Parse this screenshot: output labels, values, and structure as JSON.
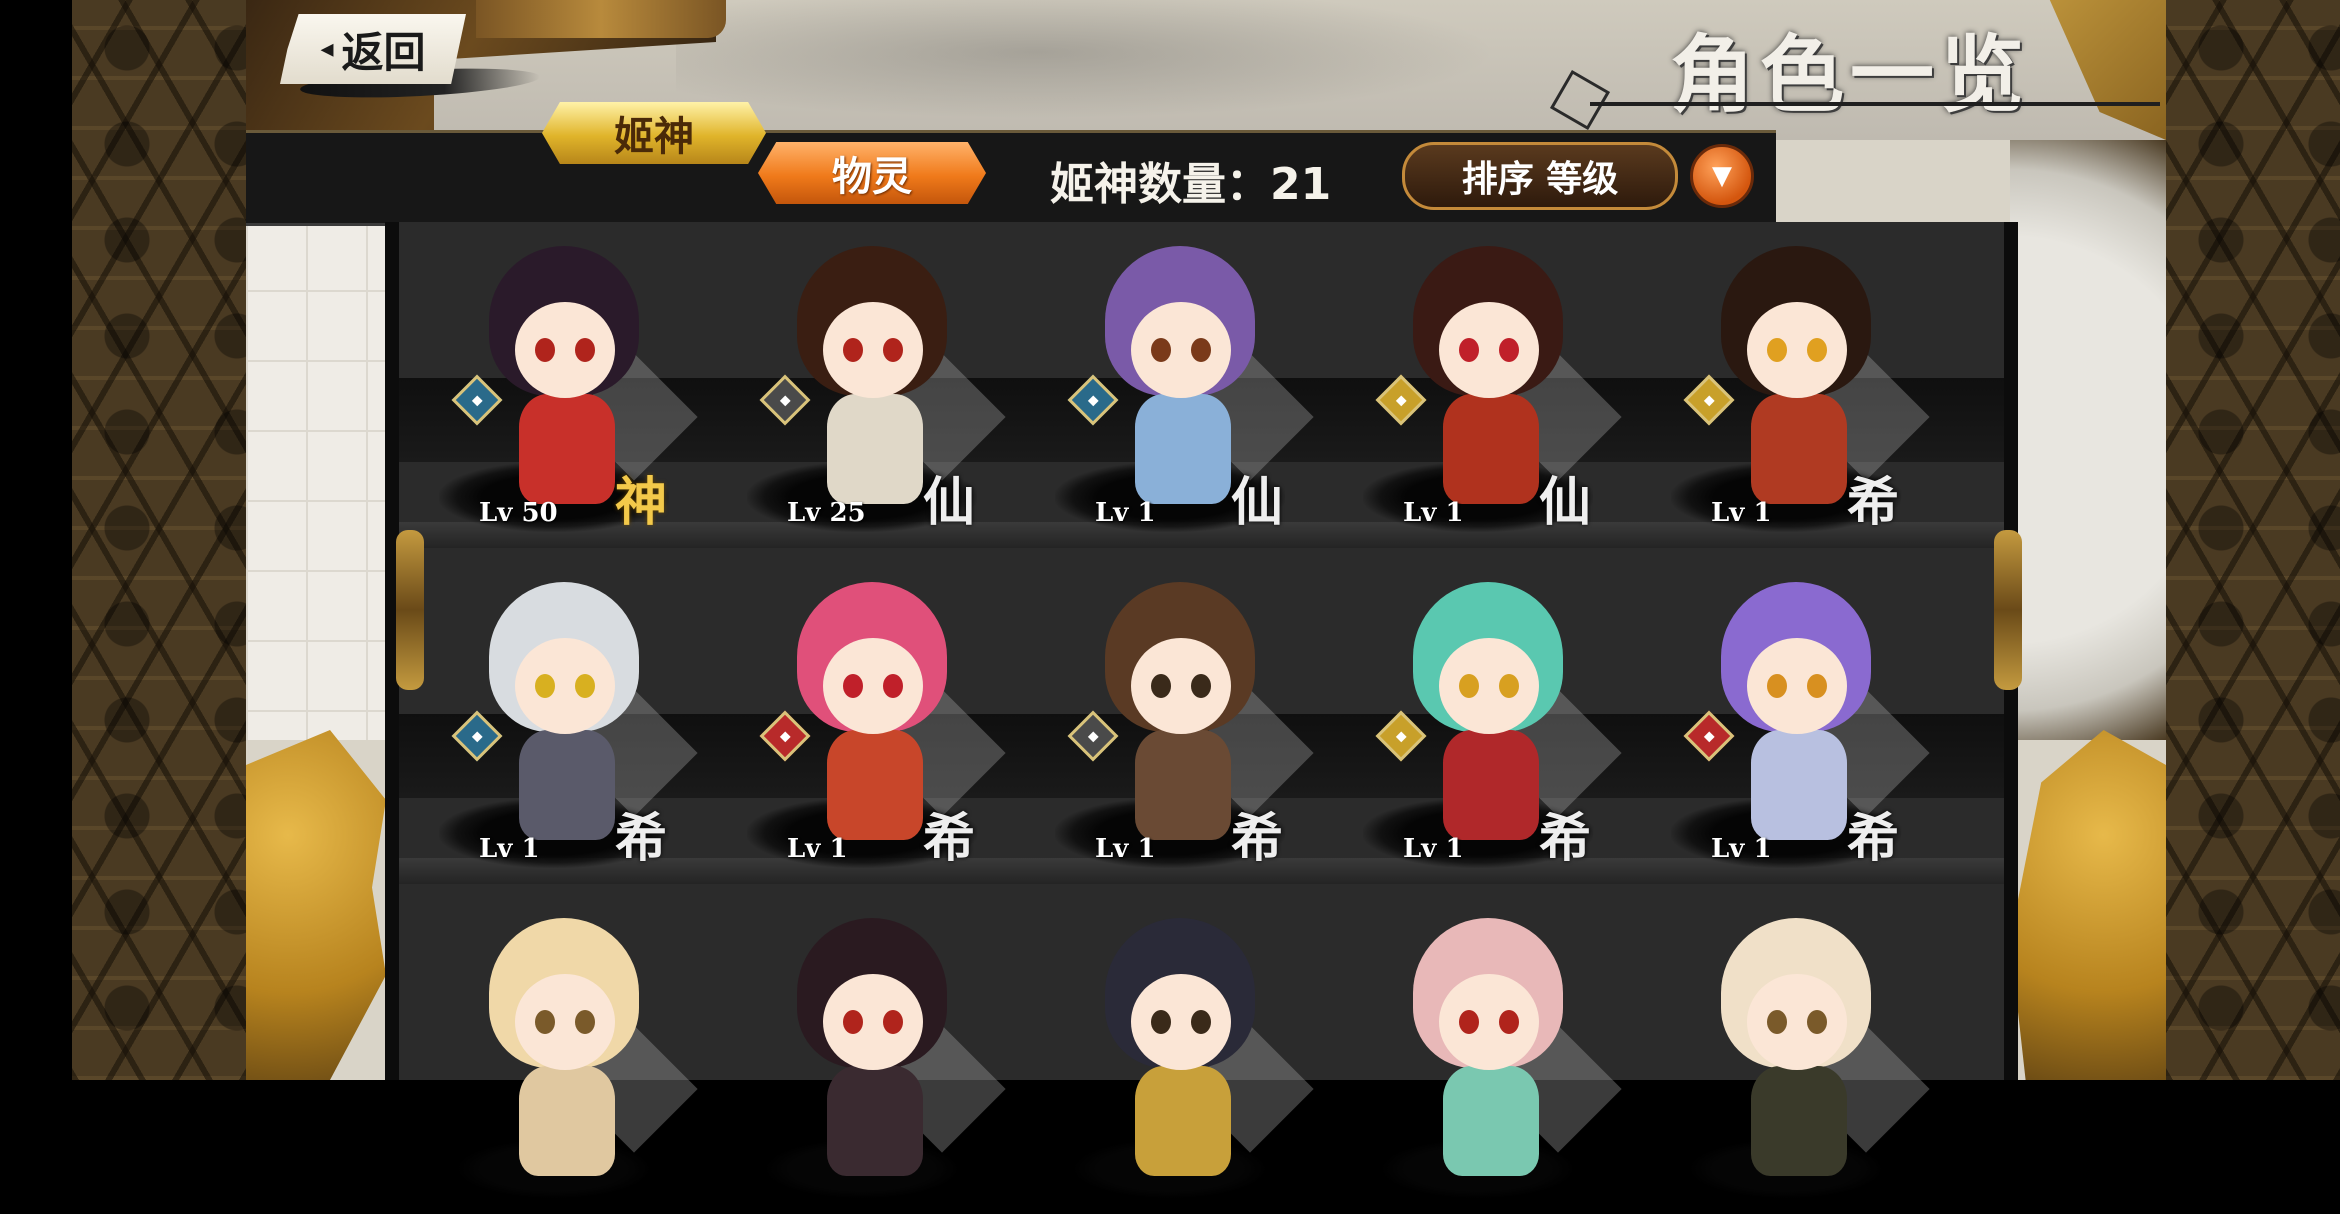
{
  "header": {
    "back_label": "返回",
    "back_arrow": "◂",
    "title": "角色一览"
  },
  "tabs": [
    {
      "label": "姬神",
      "active": true
    },
    {
      "label": "物灵",
      "active": false
    }
  ],
  "count": {
    "label": "姬神数量：21"
  },
  "sort": {
    "label": "排序 等级",
    "dropdown_icon": "▼"
  },
  "characters": [
    {
      "level": "Lv 50",
      "rarity": "神",
      "hair": "#2a1a2a",
      "outfit": "#c8302a",
      "eye": "#b0241c",
      "element": "#2a6a8a",
      "element_icon": "diamond-icon"
    },
    {
      "level": "Lv 25",
      "rarity": "仙",
      "hair": "#3a1e12",
      "outfit": "#e0d8c8",
      "eye": "#b0241c",
      "element": "#4a4a4a",
      "element_icon": "diamond-icon"
    },
    {
      "level": "Lv 1",
      "rarity": "仙",
      "hair": "#7a5aa8",
      "outfit": "#8ab0d8",
      "eye": "#7a3a1a",
      "element": "#2a6a8a",
      "element_icon": "diamond-icon"
    },
    {
      "level": "Lv 1",
      "rarity": "仙",
      "hair": "#3a1a14",
      "outfit": "#b0321e",
      "eye": "#c0202a",
      "element": "#c8a02a",
      "element_icon": "diamond-icon"
    },
    {
      "level": "Lv 1",
      "rarity": "希",
      "hair": "#2a1810",
      "outfit": "#b03a22",
      "eye": "#e0a020",
      "element": "#c8a02a",
      "element_icon": "diamond-icon"
    },
    {
      "level": "Lv 1",
      "rarity": "希",
      "hair": "#d8dce0",
      "outfit": "#5a5a6a",
      "eye": "#d8b020",
      "element": "#2a6a8a",
      "element_icon": "diamond-icon"
    },
    {
      "level": "Lv 1",
      "rarity": "希",
      "hair": "#e0507a",
      "outfit": "#c8462a",
      "eye": "#c0202a",
      "element": "#b82a2a",
      "element_icon": "diamond-icon"
    },
    {
      "level": "Lv 1",
      "rarity": "希",
      "hair": "#5a3a24",
      "outfit": "#6a4a34",
      "eye": "#3a2a1a",
      "element": "#4a4a4a",
      "element_icon": "diamond-icon"
    },
    {
      "level": "Lv 1",
      "rarity": "希",
      "hair": "#5ac8b0",
      "outfit": "#b0282a",
      "eye": "#d8a020",
      "element": "#c8a02a",
      "element_icon": "diamond-icon"
    },
    {
      "level": "Lv 1",
      "rarity": "希",
      "hair": "#8a6ad0",
      "outfit": "#b8c0e0",
      "eye": "#d89020",
      "element": "#b82a2a",
      "element_icon": "diamond-icon"
    },
    {
      "level": "",
      "rarity": "",
      "hair": "#f0d8a8",
      "outfit": "#e0c8a0",
      "eye": "#7a5a2a",
      "element": "",
      "element_icon": ""
    },
    {
      "level": "",
      "rarity": "",
      "hair": "#2a1a20",
      "outfit": "#3a2a30",
      "eye": "#b0241c",
      "element": "",
      "element_icon": ""
    },
    {
      "level": "",
      "rarity": "",
      "hair": "#2a2a38",
      "outfit": "#c8a03a",
      "eye": "#3a2a1a",
      "element": "",
      "element_icon": ""
    },
    {
      "level": "",
      "rarity": "",
      "hair": "#e8b8b8",
      "outfit": "#7ac8b0",
      "eye": "#b0241c",
      "element": "",
      "element_icon": ""
    },
    {
      "level": "",
      "rarity": "",
      "hair": "#f0e0c8",
      "outfit": "#3a3a2a",
      "eye": "#7a5a2a",
      "element": "",
      "element_icon": ""
    }
  ]
}
